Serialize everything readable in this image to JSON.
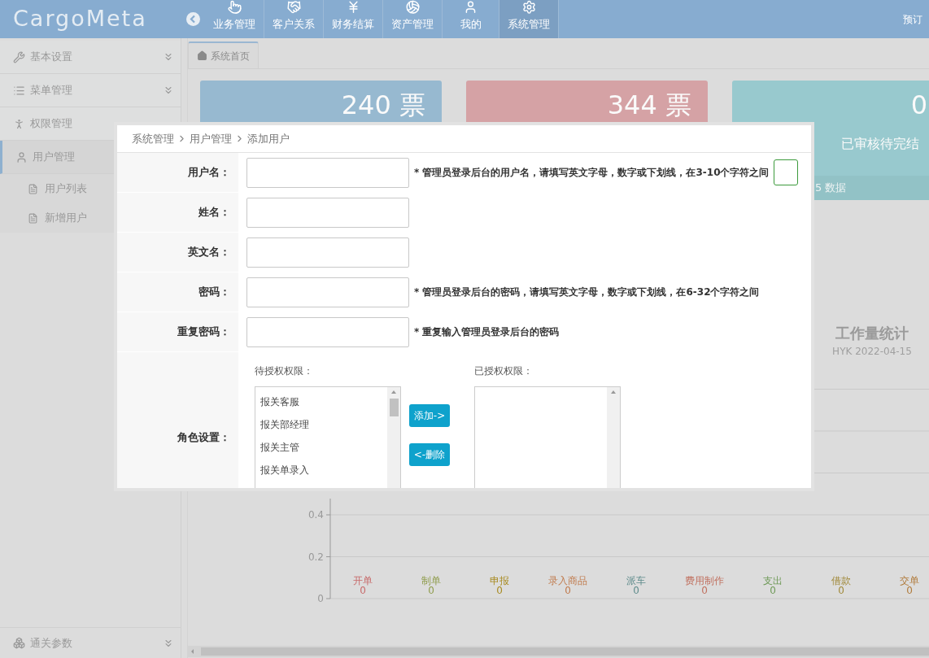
{
  "header": {
    "logo": "CargoMeta",
    "nav": [
      {
        "label": "业务管理",
        "selected": false
      },
      {
        "label": "客户关系",
        "selected": false
      },
      {
        "label": "财务结算",
        "selected": false
      },
      {
        "label": "资产管理",
        "selected": false
      },
      {
        "label": "我的",
        "selected": false
      },
      {
        "label": "系统管理",
        "selected": true
      }
    ],
    "right_text": "预订"
  },
  "sidebar": {
    "items": [
      {
        "label": "基本设置",
        "collapsible": true,
        "selected": false
      },
      {
        "label": "菜单管理",
        "collapsible": true,
        "selected": false
      },
      {
        "label": "权限管理",
        "collapsible": false,
        "selected": false
      },
      {
        "label": "用户管理",
        "collapsible": false,
        "selected": true,
        "children": [
          {
            "label": "用户列表"
          },
          {
            "label": "新增用户"
          }
        ]
      }
    ],
    "bottom_item": {
      "label": "通关参数",
      "collapsible": true
    }
  },
  "tabs": [
    {
      "label": "系统首页",
      "selected": true
    }
  ],
  "cards": [
    {
      "color": "#97b9d0",
      "value": "240 票"
    },
    {
      "color": "#d5a2a5",
      "value": "344 票"
    },
    {
      "color": "#98c9ce",
      "value": "0",
      "caption": "已审核待完结",
      "footer": "5 数据"
    }
  ],
  "chart": {
    "title": "工作量统计",
    "subtitle": "HYK 2022-04-15",
    "chart_data": {
      "type": "bar",
      "categories": [
        "开单",
        "制单",
        "申报",
        "录入商品",
        "派车",
        "费用制作",
        "支出",
        "借款",
        "交单"
      ],
      "values": [
        0,
        0,
        0,
        0,
        0,
        0,
        0,
        0,
        0
      ],
      "ylim": [
        0,
        1
      ],
      "yticks": [
        0,
        0.2,
        0.4
      ],
      "data_labels": true
    }
  },
  "modal": {
    "breadcrumb": [
      "系统管理",
      "用户管理",
      "添加用户"
    ],
    "fields": [
      {
        "label": "用户名：",
        "hint": "* 管理员登录后台的用户名，请填写英文字母，数字或下划线，在3-10个字符之间"
      },
      {
        "label": "姓名："
      },
      {
        "label": "英文名："
      },
      {
        "label": "密码：",
        "hint": "* 管理员登录后台的密码，请填写英文字母，数字或下划线，在6-32个字符之间"
      },
      {
        "label": "重复密码：",
        "hint": "* 重复输入管理员登录后台的密码"
      }
    ],
    "roles": {
      "label": "角色设置：",
      "available_label": "待授权权限：",
      "available": [
        "报关客服",
        "报关部经理",
        "报关主管",
        "报关单录入"
      ],
      "assigned_label": "已授权权限：",
      "add_button": "添加->",
      "remove_button": "<-删除"
    }
  }
}
